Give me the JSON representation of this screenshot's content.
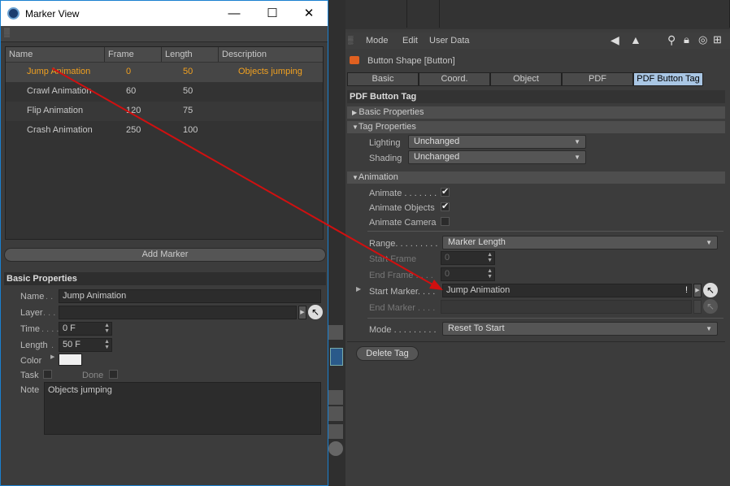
{
  "marker_view": {
    "title": "Marker View",
    "columns": [
      "Name",
      "Frame",
      "Length",
      "Description"
    ],
    "rows": [
      {
        "name": "Jump Animation",
        "frame": "0",
        "length": "50",
        "description": "Objects jumping",
        "selected": true
      },
      {
        "name": "Crawl Animation",
        "frame": "60",
        "length": "50",
        "description": ""
      },
      {
        "name": "Flip Animation",
        "frame": "120",
        "length": "75",
        "description": ""
      },
      {
        "name": "Crash Animation",
        "frame": "250",
        "length": "100",
        "description": ""
      }
    ],
    "add_marker_label": "Add Marker",
    "basic_properties": {
      "heading": "Basic Properties",
      "name_label": "Name",
      "name_value": "Jump Animation",
      "layer_label": "Layer",
      "layer_value": "",
      "time_label": "Time",
      "time_value": "0 F",
      "length_label": "Length",
      "length_value": "50 F",
      "color_label": "Color",
      "task_label": "Task",
      "done_label": "Done",
      "note_label": "Note",
      "note_value": "Objects jumping"
    }
  },
  "attributes": {
    "menu": [
      "Mode",
      "Edit",
      "User Data"
    ],
    "object_title": "Button Shape [Button]",
    "tabs": [
      "Basic",
      "Coord.",
      "Object",
      "PDF",
      "PDF Button Tag"
    ],
    "active_tab": "PDF Button Tag",
    "panel_heading": "PDF Button Tag",
    "sections": {
      "basic_properties": "Basic Properties",
      "tag_properties": "Tag Properties",
      "animation": "Animation"
    },
    "lighting_label": "Lighting",
    "lighting_value": "Unchanged",
    "shading_label": "Shading",
    "shading_value": "Unchanged",
    "animate_label": "Animate . . . . . . .",
    "animate_objects_label": "Animate Objects",
    "animate_camera_label": "Animate Camera",
    "range_label": "Range. . . . . . . . .",
    "range_value": "Marker Length",
    "start_frame_label": "Start Frame",
    "start_frame_value": "0",
    "end_frame_label": "End Frame . . . .",
    "end_frame_value": "0",
    "start_marker_label": "Start Marker. . . .",
    "start_marker_value": "Jump Animation",
    "end_marker_label": "End Marker . . . .",
    "mode_label": "Mode . . . . . . . . .",
    "mode_value": "Reset To Start",
    "delete_tag_label": "Delete Tag"
  },
  "colors": {
    "accent": "#f0a020",
    "arrow": "#d01010",
    "active_tab": "#a9c6e4",
    "window_border": "#1a80d0"
  }
}
